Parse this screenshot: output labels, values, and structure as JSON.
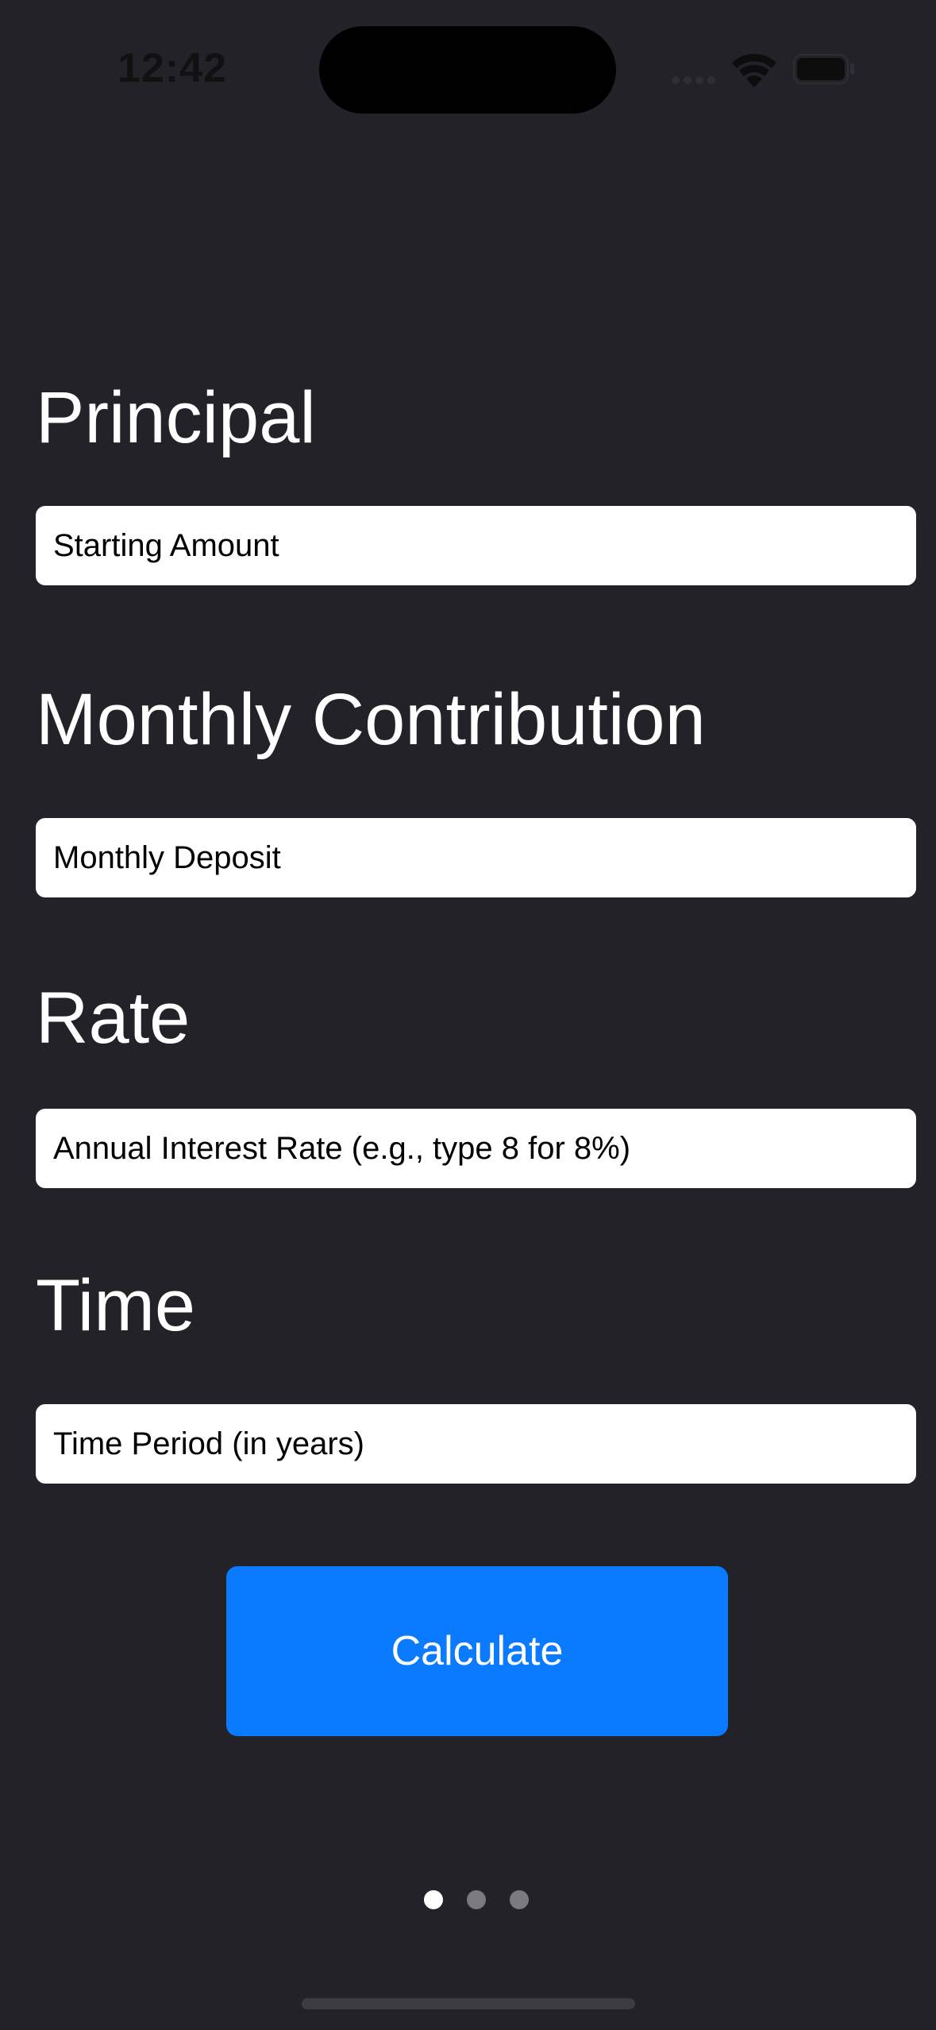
{
  "status_bar": {
    "time": "12:42",
    "icons": [
      "cellular-signal-icon",
      "wifi-icon",
      "battery-icon"
    ]
  },
  "form": {
    "principal": {
      "label": "Principal",
      "placeholder": "Starting Amount",
      "value": ""
    },
    "monthly_contribution": {
      "label": "Monthly Contribution",
      "placeholder": "Monthly Deposit",
      "value": ""
    },
    "rate": {
      "label": "Rate",
      "placeholder": "Annual Interest Rate (e.g., type 8 for 8%)",
      "value": ""
    },
    "time": {
      "label": "Time",
      "placeholder": "Time Period (in years)",
      "value": ""
    },
    "calculate_label": "Calculate"
  },
  "pager": {
    "pages": 3,
    "current": 1
  },
  "colors": {
    "background": "#232228",
    "button": "#0a7aff",
    "field": "#ffffff",
    "dot_active": "#ffffff",
    "dot_inactive": "#7b7a80"
  }
}
